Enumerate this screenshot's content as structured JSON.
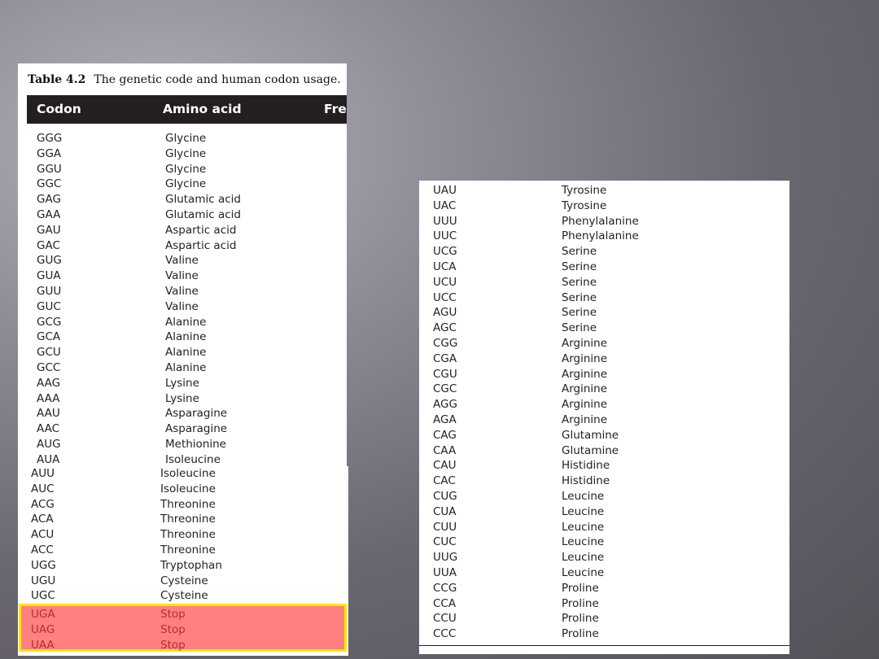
{
  "caption": {
    "label": "Table 4.2",
    "text": "The genetic code and human codon usage."
  },
  "headers": {
    "codon": "Codon",
    "amino_acid": "Amino acid",
    "frequency": "Fre"
  },
  "left_top_rows": [
    {
      "codon": "GGG",
      "amino": "Glycine"
    },
    {
      "codon": "GGA",
      "amino": "Glycine"
    },
    {
      "codon": "GGU",
      "amino": "Glycine"
    },
    {
      "codon": "GGC",
      "amino": "Glycine"
    },
    {
      "codon": "GAG",
      "amino": "Glutamic acid"
    },
    {
      "codon": "GAA",
      "amino": "Glutamic acid"
    },
    {
      "codon": "GAU",
      "amino": "Aspartic acid"
    },
    {
      "codon": "GAC",
      "amino": "Aspartic acid"
    },
    {
      "codon": "GUG",
      "amino": "Valine"
    },
    {
      "codon": "GUA",
      "amino": "Valine"
    },
    {
      "codon": "GUU",
      "amino": "Valine"
    },
    {
      "codon": "GUC",
      "amino": "Valine"
    },
    {
      "codon": "GCG",
      "amino": "Alanine"
    },
    {
      "codon": "GCA",
      "amino": "Alanine"
    },
    {
      "codon": "GCU",
      "amino": "Alanine"
    },
    {
      "codon": "GCC",
      "amino": "Alanine"
    },
    {
      "codon": "AAG",
      "amino": "Lysine"
    },
    {
      "codon": "AAA",
      "amino": "Lysine"
    },
    {
      "codon": "AAU",
      "amino": "Asparagine"
    },
    {
      "codon": "AAC",
      "amino": "Asparagine"
    },
    {
      "codon": "AUG",
      "amino": "Methionine"
    },
    {
      "codon": "AUA",
      "amino": "Isoleucine"
    }
  ],
  "left_bottom_rows": [
    {
      "codon": "AUU",
      "amino": "Isoleucine"
    },
    {
      "codon": "AUC",
      "amino": "Isoleucine"
    },
    {
      "codon": "ACG",
      "amino": "Threonine"
    },
    {
      "codon": "ACA",
      "amino": "Threonine"
    },
    {
      "codon": "ACU",
      "amino": "Threonine"
    },
    {
      "codon": "ACC",
      "amino": "Threonine"
    },
    {
      "codon": "UGG",
      "amino": "Tryptophan"
    },
    {
      "codon": "UGU",
      "amino": "Cysteine"
    },
    {
      "codon": "UGC",
      "amino": "Cysteine"
    }
  ],
  "stop_rows": [
    {
      "codon": "UGA",
      "amino": "Stop"
    },
    {
      "codon": "UAG",
      "amino": "Stop"
    },
    {
      "codon": "UAA",
      "amino": "Stop"
    }
  ],
  "right_rows": [
    {
      "codon": "UAU",
      "amino": "Tyrosine"
    },
    {
      "codon": "UAC",
      "amino": "Tyrosine"
    },
    {
      "codon": "UUU",
      "amino": "Phenylalanine"
    },
    {
      "codon": "UUC",
      "amino": "Phenylalanine"
    },
    {
      "codon": "UCG",
      "amino": "Serine"
    },
    {
      "codon": "UCA",
      "amino": "Serine"
    },
    {
      "codon": "UCU",
      "amino": "Serine"
    },
    {
      "codon": "UCC",
      "amino": "Serine"
    },
    {
      "codon": "AGU",
      "amino": "Serine"
    },
    {
      "codon": "AGC",
      "amino": "Serine"
    },
    {
      "codon": "CGG",
      "amino": "Arginine"
    },
    {
      "codon": "CGA",
      "amino": "Arginine"
    },
    {
      "codon": "CGU",
      "amino": "Arginine"
    },
    {
      "codon": "CGC",
      "amino": "Arginine"
    },
    {
      "codon": "AGG",
      "amino": "Arginine"
    },
    {
      "codon": "AGA",
      "amino": "Arginine"
    },
    {
      "codon": "CAG",
      "amino": "Glutamine"
    },
    {
      "codon": "CAA",
      "amino": "Glutamine"
    },
    {
      "codon": "CAU",
      "amino": "Histidine"
    },
    {
      "codon": "CAC",
      "amino": "Histidine"
    },
    {
      "codon": "CUG",
      "amino": "Leucine"
    },
    {
      "codon": "CUA",
      "amino": "Leucine"
    },
    {
      "codon": "CUU",
      "amino": "Leucine"
    },
    {
      "codon": "CUC",
      "amino": "Leucine"
    },
    {
      "codon": "UUG",
      "amino": "Leucine"
    },
    {
      "codon": "UUA",
      "amino": "Leucine"
    },
    {
      "codon": "CCG",
      "amino": "Proline"
    },
    {
      "codon": "CCA",
      "amino": "Proline"
    },
    {
      "codon": "CCU",
      "amino": "Proline"
    },
    {
      "codon": "CCC",
      "amino": "Proline"
    }
  ],
  "colors": {
    "header_bg": "#231f20",
    "stop_highlight": "#ff8080",
    "stop_border": "#ffe600",
    "stop_text": "#c0282c"
  }
}
